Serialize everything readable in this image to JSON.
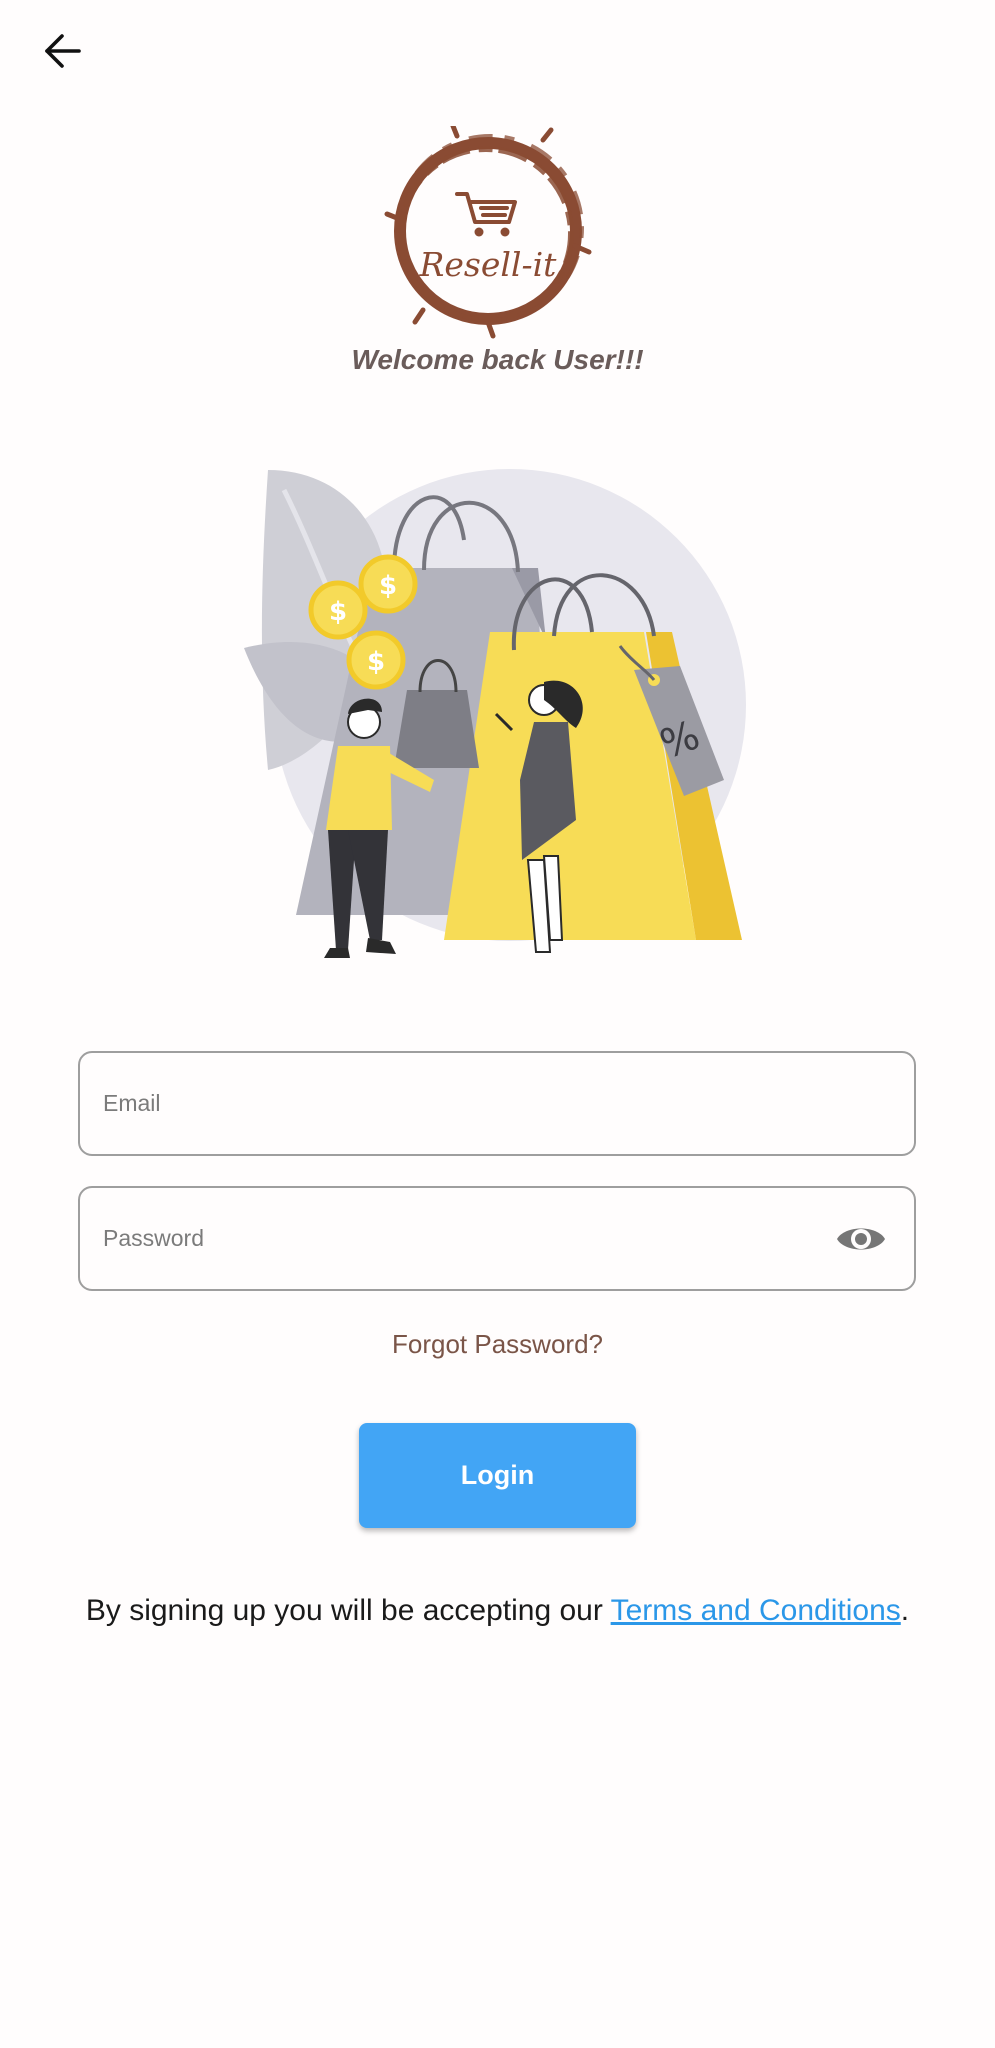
{
  "app": {
    "logo_text": "Resell-it",
    "welcome": "Welcome back User!!!"
  },
  "form": {
    "email": {
      "placeholder": "Email",
      "value": ""
    },
    "password": {
      "placeholder": "Password",
      "value": ""
    },
    "forgot_label": "Forgot Password?",
    "login_label": "Login"
  },
  "terms": {
    "prefix": "By signing up you will be accepting our ",
    "link": "Terms and Conditions",
    "suffix": "."
  },
  "colors": {
    "brand_brown": "#7a5548",
    "primary_blue": "#42a5f5",
    "link_blue": "#2b97e8",
    "field_border": "#9e9e9e"
  },
  "icons": {
    "back": "arrow-left-icon",
    "password_toggle": "eye-icon"
  }
}
